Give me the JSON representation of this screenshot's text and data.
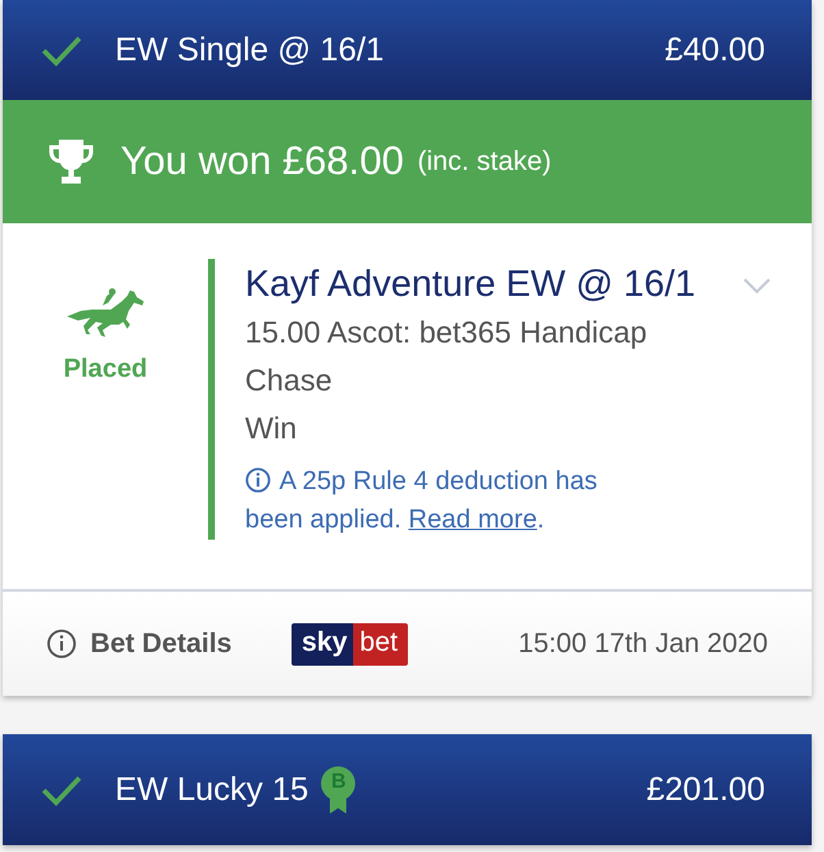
{
  "bets": [
    {
      "header": {
        "title": "EW Single @ 16/1",
        "stake": "£40.00",
        "settled": true
      },
      "result": {
        "text": "You won £68.00",
        "note": "(inc. stake)"
      },
      "selection": {
        "status": "Placed",
        "name": "Kayf Adventure EW @ 16/1",
        "event": "15.00 Ascot: bet365 Handicap Chase",
        "market": "Win",
        "notice": {
          "text": "A 25p Rule 4 deduction has been applied.",
          "link": "Read more",
          "after": "."
        }
      },
      "footer": {
        "details_label": "Bet Details",
        "logo": [
          "sky",
          "bet"
        ],
        "date": "15:00 17th Jan 2020"
      }
    },
    {
      "header": {
        "title": "EW Lucky 15",
        "stake": "£201.00",
        "settled": true,
        "badge": "B"
      }
    }
  ]
}
